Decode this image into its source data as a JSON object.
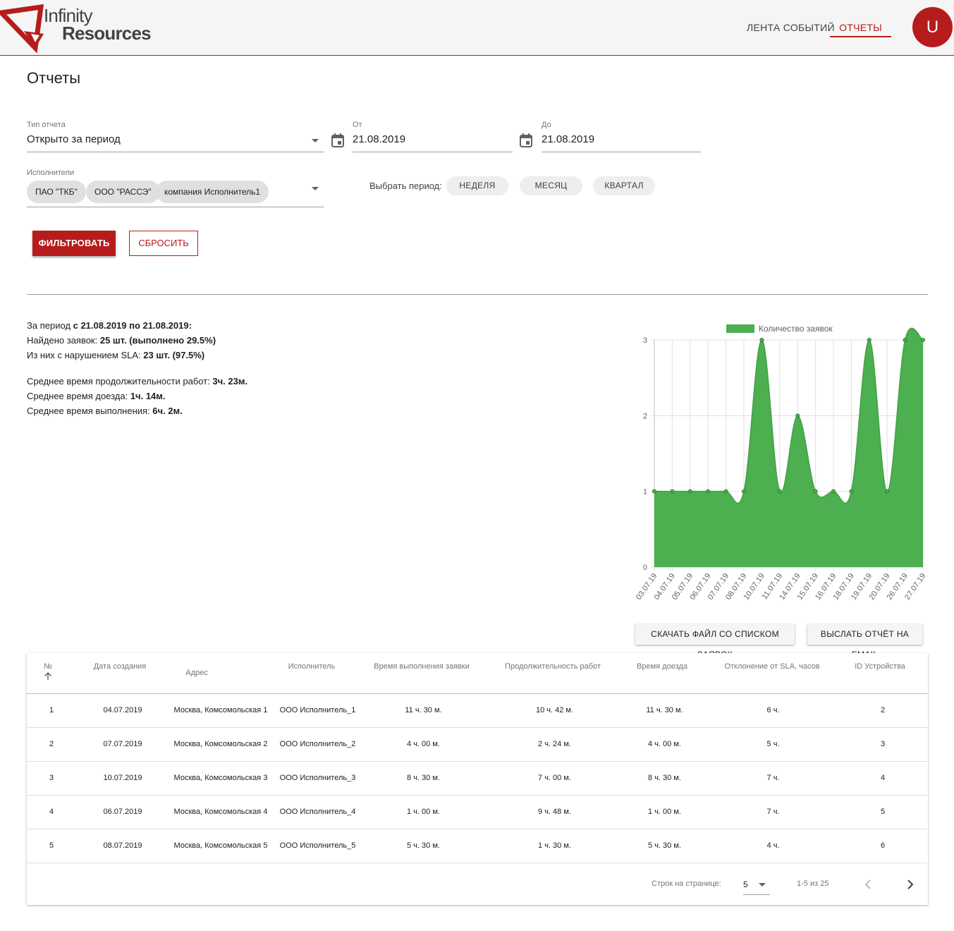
{
  "brand": {
    "line1": "Infinity",
    "line2": "Resources",
    "accent": "#b71c1c"
  },
  "nav": {
    "feed": "ЛЕНТА СОБЫТИЙ",
    "reports": "ОТЧЕТЫ"
  },
  "user": {
    "initial": "U"
  },
  "page": {
    "title": "Отчеты"
  },
  "filters": {
    "type": {
      "label": "Тип отчета",
      "value": "Открыто за период"
    },
    "from": {
      "label": "От",
      "value": "21.08.2019"
    },
    "to": {
      "label": "До",
      "value": "21.08.2019"
    },
    "executors": {
      "label": "Исполнители",
      "chips": [
        "ПАО \"ТКБ\"",
        "ООО \"РАССЭ\"",
        "компания Исполнитель1"
      ]
    },
    "period": {
      "label": "Выбрать период:",
      "week": "НЕДЕЛЯ",
      "month": "МЕСЯЦ",
      "quarter": "КВАРТАЛ"
    },
    "filter_label": "ФИЛЬТРОВАТЬ",
    "reset_label": "СБРОСИТЬ"
  },
  "summary": {
    "period_prefix": "За период ",
    "period_value": "с 21.08.2019 по 21.08.2019:",
    "found_prefix": "Найдено заявок: ",
    "found_value": "25 шт. (выполнено 29.5%)",
    "sla_prefix": "Из них с нарушением SLA: ",
    "sla_value": "23 шт. (97.5%)",
    "avg_work_prefix": "Среднее время продолжительности работ: ",
    "avg_work_value": "3ч. 23м.",
    "avg_travel_prefix": "Среднее время доезда: ",
    "avg_travel_value": "1ч. 14м.",
    "avg_exec_prefix": "Среднее время выполнения: ",
    "avg_exec_value": "6ч. 2м."
  },
  "chart_data": {
    "type": "area",
    "x": [
      "03.07.19",
      "04.07.19",
      "05.07.19",
      "06.07.19",
      "07.07.19",
      "08.07.19",
      "10.07.19",
      "11.07.19",
      "14.07.19",
      "15.07.19",
      "16.07.19",
      "18.07.19",
      "19.07.19",
      "20.07.19",
      "26.07.19",
      "27.07.19"
    ],
    "series": [
      {
        "name": "Количество заявок",
        "values": [
          1,
          1,
          1,
          1,
          1,
          1,
          3,
          1,
          2,
          1,
          1,
          1,
          3,
          1,
          3,
          3
        ],
        "color": "#4caf50"
      }
    ],
    "ylim": [
      0,
      3
    ],
    "yticks": [
      "0",
      "1",
      "2",
      "3"
    ],
    "grid": true,
    "legend": "top"
  },
  "actions": {
    "download": "СКАЧАТЬ ФАЙЛ СО СПИСКОМ ЗАЯВОК",
    "email": "ВЫСЛАТЬ ОТЧЁТ НА EMAIL"
  },
  "table": {
    "headers": {
      "num": "№",
      "date": "Дата создания",
      "address": "Адрес",
      "executor": "Исполнитель",
      "exec_time": "Время выполнения заявки",
      "work_duration": "Продолжительность работ",
      "travel_time": "Время доезда",
      "sla_dev": "Отклонение от SLA, часов",
      "device_id": "ID Устройства"
    },
    "rows": [
      {
        "num": "1",
        "date": "04.07.2019",
        "address": "Москва, Комсомольская 1",
        "executor": "ООО Исполнитель_1",
        "exec_time": "11 ч. 30 м.",
        "work_duration": "10 ч. 42 м.",
        "travel_time": "11 ч. 30 м.",
        "sla_dev": "6 ч.",
        "device_id": "2"
      },
      {
        "num": "2",
        "date": "07.07.2019",
        "address": "Москва, Комсомольская 2",
        "executor": "ООО Исполнитель_2",
        "exec_time": "4 ч. 00 м.",
        "work_duration": "2 ч. 24 м.",
        "travel_time": "4 ч. 00 м.",
        "sla_dev": "5 ч.",
        "device_id": "3"
      },
      {
        "num": "3",
        "date": "10.07.2019",
        "address": "Москва, Комсомольская 3",
        "executor": "ООО Исполнитель_3",
        "exec_time": "8 ч. 30 м.",
        "work_duration": "7 ч. 00 м.",
        "travel_time": "8 ч. 30 м.",
        "sla_dev": "7 ч.",
        "device_id": "4"
      },
      {
        "num": "4",
        "date": "06.07.2019",
        "address": "Москва, Комсомольская 4",
        "executor": "ООО Исполнитель_4",
        "exec_time": "1 ч. 00 м.",
        "work_duration": "9 ч. 48 м.",
        "travel_time": "1 ч. 00 м.",
        "sla_dev": "7 ч.",
        "device_id": "5"
      },
      {
        "num": "5",
        "date": "08.07.2019",
        "address": "Москва, Комсомольская 5",
        "executor": "ООО Исполнитель_5",
        "exec_time": "5 ч. 30 м.",
        "work_duration": "1 ч. 30 м.",
        "travel_time": "5 ч. 30 м.",
        "sla_dev": "4 ч.",
        "device_id": "6"
      }
    ],
    "footer": {
      "rows_per_page_label": "Строк на странице:",
      "rows_per_page": "5",
      "range": "1-5 из 25"
    }
  }
}
